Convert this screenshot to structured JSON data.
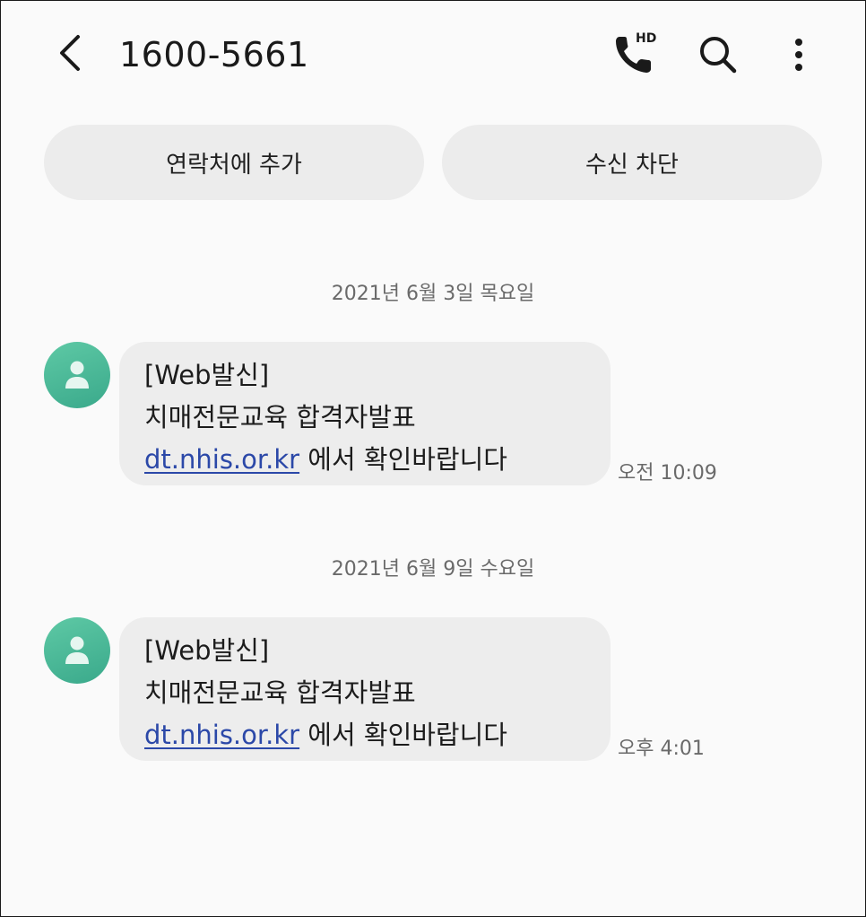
{
  "header": {
    "back_icon": "chevron-left-icon",
    "title": "1600-5661",
    "hd_call": {
      "icon": "phone-hd-icon",
      "label": "HD"
    },
    "search_icon": "search-icon",
    "more_icon": "more-vertical-icon"
  },
  "actions": {
    "add_contact": "연락처에 추가",
    "block": "수신 차단"
  },
  "accent_color": "#45b694",
  "link_color": "#2b48a8",
  "messages": [
    {
      "date": "2021년 6월 3일 목요일",
      "line1": "[Web발신]",
      "line2": "치매전문교육 합격자발표",
      "link": "dt.nhis.or.kr",
      "line3_rest": " 에서 확인바랍니다",
      "time": "오전 10:09"
    },
    {
      "date": "2021년 6월 9일 수요일",
      "line1": "[Web발신]",
      "line2": "치매전문교육 합격자발표",
      "link": "dt.nhis.or.kr",
      "line3_rest": " 에서 확인바랍니다",
      "time": "오후 4:01"
    }
  ]
}
